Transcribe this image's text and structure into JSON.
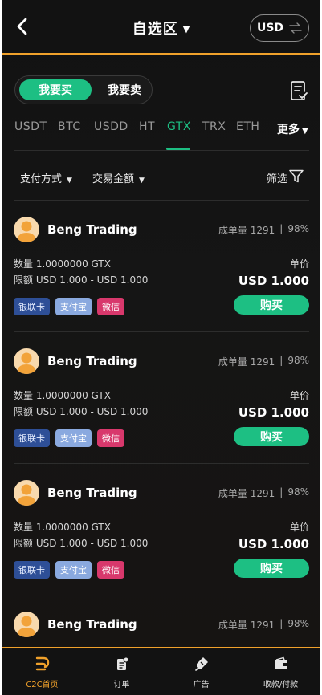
{
  "header": {
    "title": "自选区",
    "currency_button": "USD"
  },
  "trade_toggle": {
    "buy_label": "我要买",
    "sell_label": "我要卖"
  },
  "coin_tabs": [
    "USDT",
    "BTC",
    "USDD",
    "HT",
    "GTX",
    "TRX",
    "ETH"
  ],
  "active_coin": "GTX",
  "more_label": "更多",
  "filters": {
    "payment_method": "支付方式",
    "trade_amount": "交易金额",
    "screen": "筛选"
  },
  "listings": [
    {
      "merchant": "Beng Trading",
      "orders_label": "成单量 1291",
      "rate": "98%",
      "quantity": "数量 1.0000000 GTX",
      "limit": "限额 USD 1.000 - USD 1.000",
      "price_label": "单价",
      "price": "USD 1.000",
      "pay_methods": [
        "银联卡",
        "支付宝",
        "微信"
      ],
      "buy_label": "购买"
    },
    {
      "merchant": "Beng Trading",
      "orders_label": "成单量 1291",
      "rate": "98%",
      "quantity": "数量 1.0000000 GTX",
      "limit": "限额 USD 1.000 - USD 1.000",
      "price_label": "单价",
      "price": "USD 1.000",
      "pay_methods": [
        "银联卡",
        "支付宝",
        "微信"
      ],
      "buy_label": "购买"
    },
    {
      "merchant": "Beng Trading",
      "orders_label": "成单量 1291",
      "rate": "98%",
      "quantity": "数量 1.0000000 GTX",
      "limit": "限额 USD 1.000 - USD 1.000",
      "price_label": "单价",
      "price": "USD 1.000",
      "pay_methods": [
        "银联卡",
        "支付宝",
        "微信"
      ],
      "buy_label": "购买"
    },
    {
      "merchant": "Beng Trading",
      "orders_label": "成单量 1291",
      "rate": "98%"
    }
  ],
  "bottom_nav": [
    {
      "label": "C2C首页",
      "icon": "c2c-home-icon",
      "active": true
    },
    {
      "label": "订单",
      "icon": "orders-icon",
      "active": false
    },
    {
      "label": "广告",
      "icon": "ads-icon",
      "active": false
    },
    {
      "label": "收款/付款",
      "icon": "wallet-icon",
      "active": false
    }
  ],
  "colors": {
    "accent_green": "#1dbf83",
    "accent_orange": "#f0a12b",
    "unionpay": "#2e4f97",
    "alipay": "#8aa9df",
    "wechat": "#d8386c"
  }
}
